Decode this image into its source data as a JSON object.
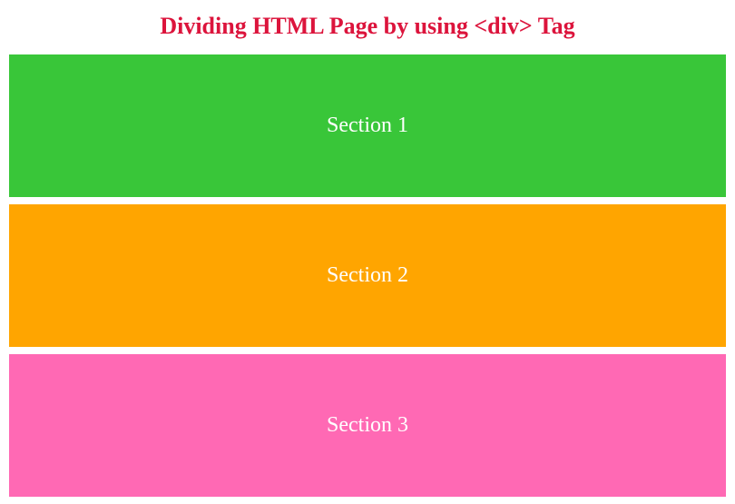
{
  "heading": "Dividing HTML Page by using <div> Tag",
  "sections": [
    {
      "label": "Section 1"
    },
    {
      "label": "Section 2"
    },
    {
      "label": "Section 3"
    }
  ]
}
